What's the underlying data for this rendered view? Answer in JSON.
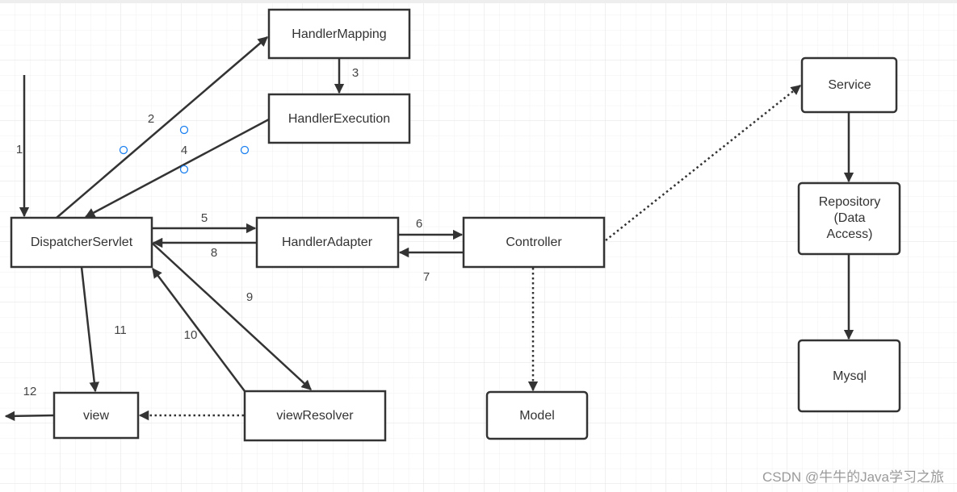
{
  "diagram": {
    "nodes": {
      "handler_mapping": "HandlerMapping",
      "handler_execution": "HandlerExecution",
      "dispatcher_servlet": "DispatcherServlet",
      "handler_adapter": "HandlerAdapter",
      "controller": "Controller",
      "service": "Service",
      "repository": [
        "Repository",
        "(Data",
        "Access)"
      ],
      "mysql": "Mysql",
      "view": "view",
      "view_resolver": "viewResolver",
      "model": "Model"
    },
    "edge_labels": [
      "1",
      "2",
      "3",
      "4",
      "5",
      "6",
      "7",
      "8",
      "9",
      "10",
      "11",
      "12"
    ]
  },
  "watermark": "CSDN @牛牛的Java学习之旅",
  "colors": {
    "grid_minor": "#f0f0f0",
    "grid_major": "#e2e2e2",
    "stroke": "#333333",
    "selection_handle": "#1a7ff0"
  }
}
